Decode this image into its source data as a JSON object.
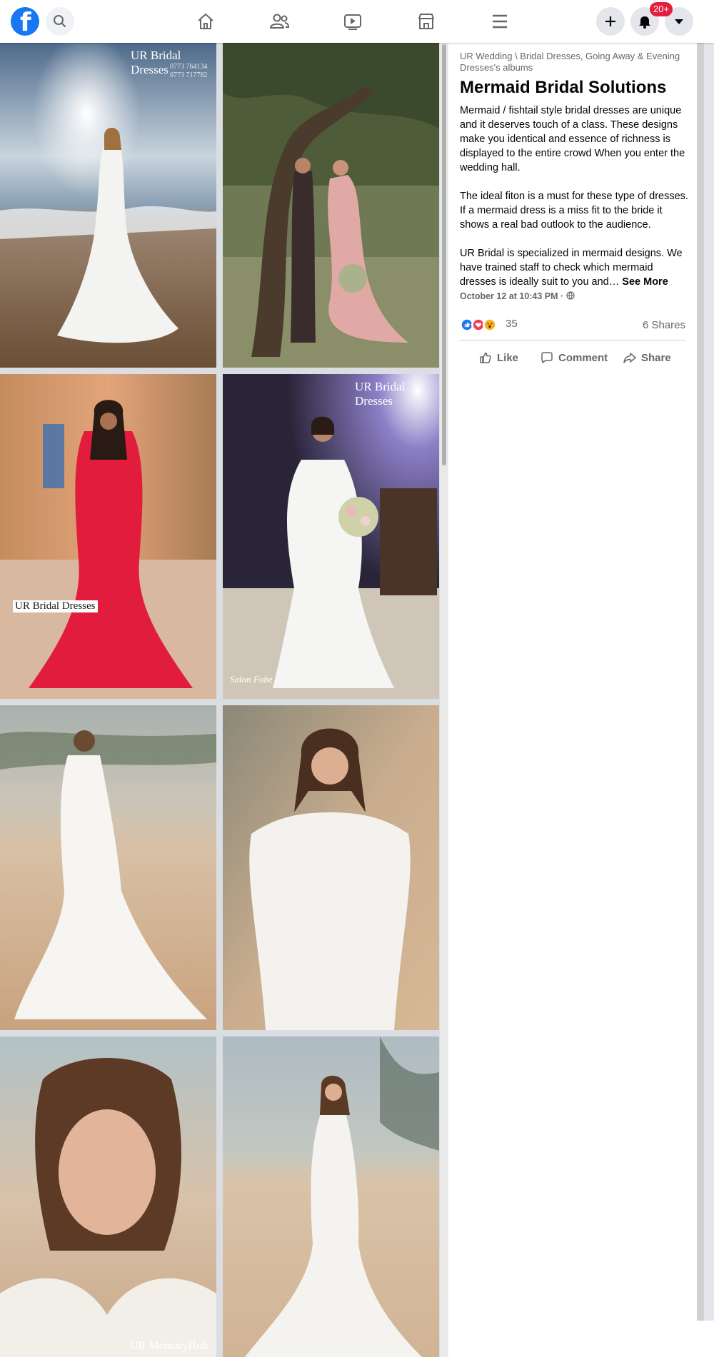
{
  "nav": {
    "logo_icon": "facebook-logo",
    "search_icon": "search-icon",
    "center_icons": [
      "home-icon",
      "friends-icon",
      "watch-icon",
      "marketplace-icon",
      "menu-icon"
    ],
    "right_icons": [
      "create-icon",
      "notifications-icon",
      "account-dropdown-icon"
    ],
    "notification_badge": "20+",
    "badge_color": "#e41e3f",
    "brand_color": "#1877f2"
  },
  "photos": {
    "watermarks": {
      "p1_brand": "UR Bridal Dresses",
      "p1_phone1": "0773 764134",
      "p1_phone2": "0773 717782",
      "p3_brand": "UR Bridal Dresses",
      "p4_brand": "UR Bridal Dresses",
      "p4_salon": "Salon Fobe",
      "p7_mark": "UR MemoryHub"
    }
  },
  "post": {
    "album_path": "UR Wedding \\ Bridal Dresses, Going Away & Evening Dresses's albums",
    "title": "Mermaid Bridal Solutions",
    "paragraph1": "Mermaid / fishtail style bridal dresses are unique and it deserves touch of a class. These designs make you identical and essence of richness is displayed to the entire crowd When you enter the wedding hall.",
    "paragraph2": "The ideal fiton is a must for these type of dresses. If a mermaid dress is a miss fit to the bride it shows a real bad outlook to the audience.",
    "paragraph3": "UR Bridal is specialized in mermaid designs. We have trained staff to check which mermaid dresses is ideally suit to you and…",
    "see_more": "See More",
    "timestamp": "October 12 at 10:43 PM ·",
    "privacy_icon": "globe-icon",
    "reaction_icons": [
      "like-icon",
      "love-icon",
      "wow-icon"
    ],
    "reaction_count": "35",
    "shares": "6 Shares",
    "actions": {
      "like": "Like",
      "comment": "Comment",
      "share": "Share"
    }
  }
}
